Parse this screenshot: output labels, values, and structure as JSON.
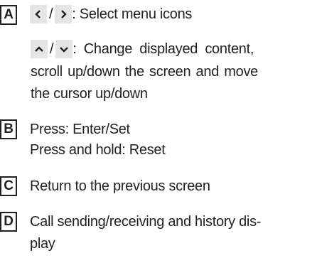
{
  "colors": {
    "text": "#231f20",
    "key_background": "#e5e5e5"
  },
  "items": [
    {
      "letter": "A",
      "keys_lr": {
        "left_icon": "chevron-left-icon",
        "sep": "/",
        "right_icon": "chevron-right-icon"
      },
      "text_lr": ": Select menu icons",
      "keys_ud": {
        "up_icon": "chevron-up-icon",
        "sep": "/",
        "down_icon": "chevron-down-icon"
      },
      "text_ud_first": ": Change displayed content,",
      "text_ud_second": "scroll up/down the screen and move",
      "text_ud_third": "the cursor up/down"
    },
    {
      "letter": "B",
      "line1": "Press: Enter/Set",
      "line2": "Press and hold: Reset"
    },
    {
      "letter": "C",
      "line1": "Return to the previous screen"
    },
    {
      "letter": "D",
      "line1": "Call sending/receiving and history dis-",
      "line2": "play"
    }
  ]
}
